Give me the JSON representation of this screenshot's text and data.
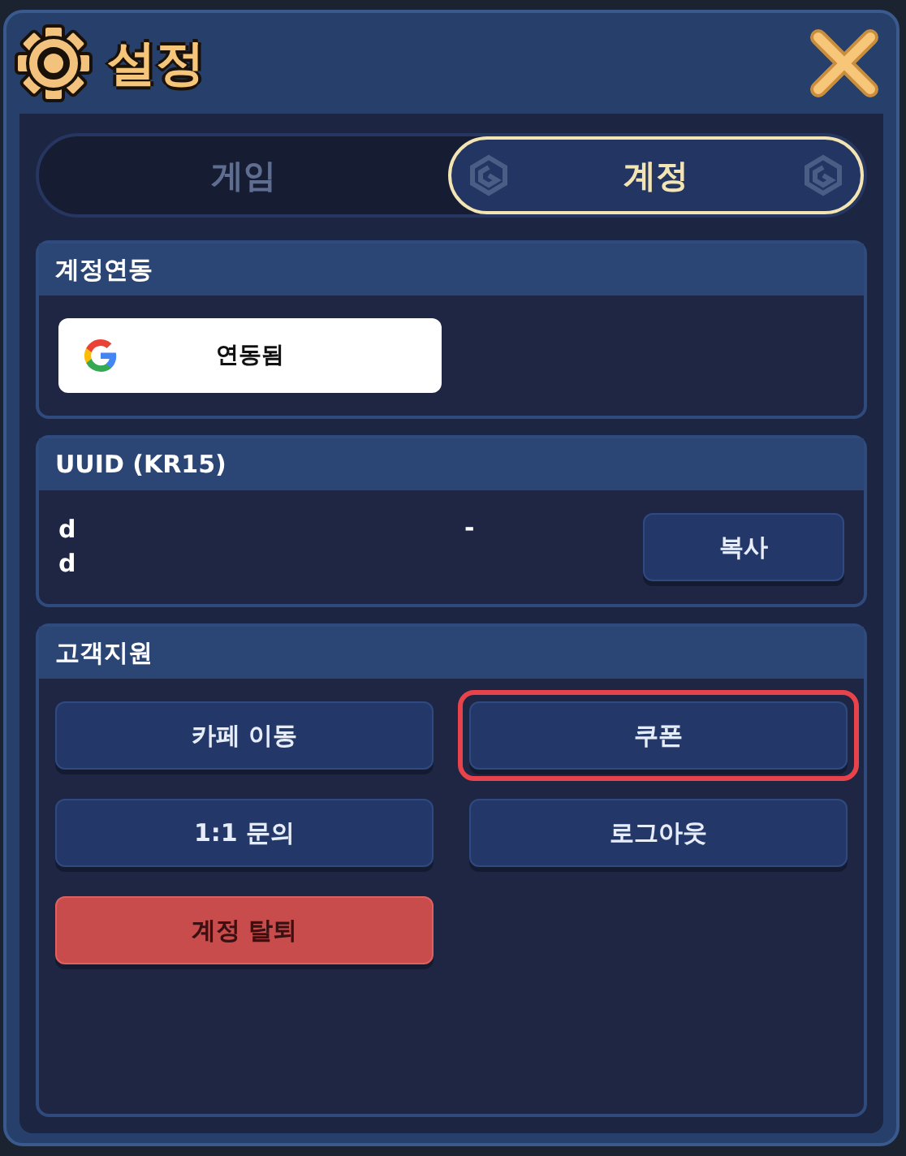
{
  "window": {
    "title": "설정"
  },
  "tabs": [
    {
      "label": "게임",
      "selected": false
    },
    {
      "label": "계정",
      "selected": true
    }
  ],
  "account_link": {
    "title": "계정연동",
    "button": {
      "label": "연동됨"
    }
  },
  "uuid": {
    "title": "UUID (KR15)",
    "lines": [
      "d",
      "d"
    ],
    "separator": "-",
    "button": "복사"
  },
  "support": {
    "title": "고객지원",
    "buttons": [
      {
        "label": "카페 이동",
        "kind": "normal",
        "highlighted": false
      },
      {
        "label": "쿠폰",
        "kind": "normal",
        "highlighted": true
      },
      {
        "label": "1:1 문의",
        "kind": "normal",
        "highlighted": false
      },
      {
        "label": "로그아웃",
        "kind": "normal",
        "highlighted": false
      },
      {
        "label": "계정 탈퇴",
        "kind": "danger",
        "highlighted": false
      }
    ]
  }
}
